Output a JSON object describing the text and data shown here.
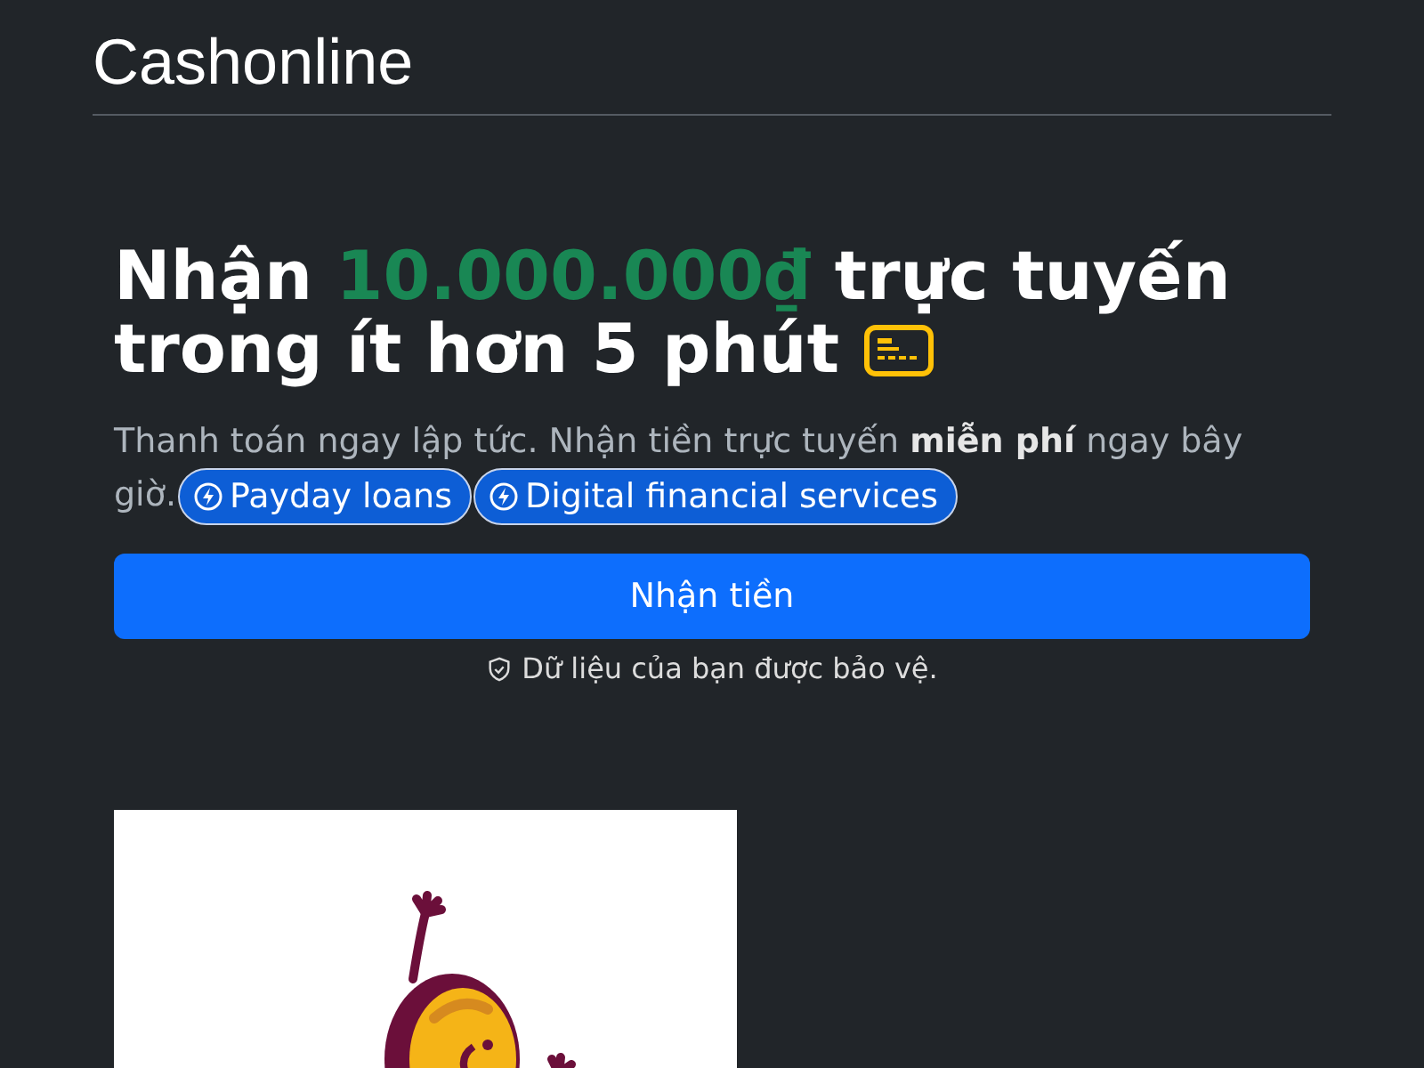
{
  "brand": "Cashonline",
  "heading": {
    "text_before": "Nhận ",
    "amount": "10.000.000₫",
    "text_after": " trực tuyến trong ít hơn 5 phút"
  },
  "subtitle_lines": [
    "Thanh toán ngay lập tức. Nhận tiền trực tuyến **miễn phí** ngay bây",
    "giờ."
  ],
  "tags": [
    {
      "label": "Payday loans"
    },
    {
      "label": "Digital financial services"
    }
  ],
  "cta_button": "Nhận tiền",
  "privacy_note": "Dữ liệu của bạn được bảo vệ."
}
